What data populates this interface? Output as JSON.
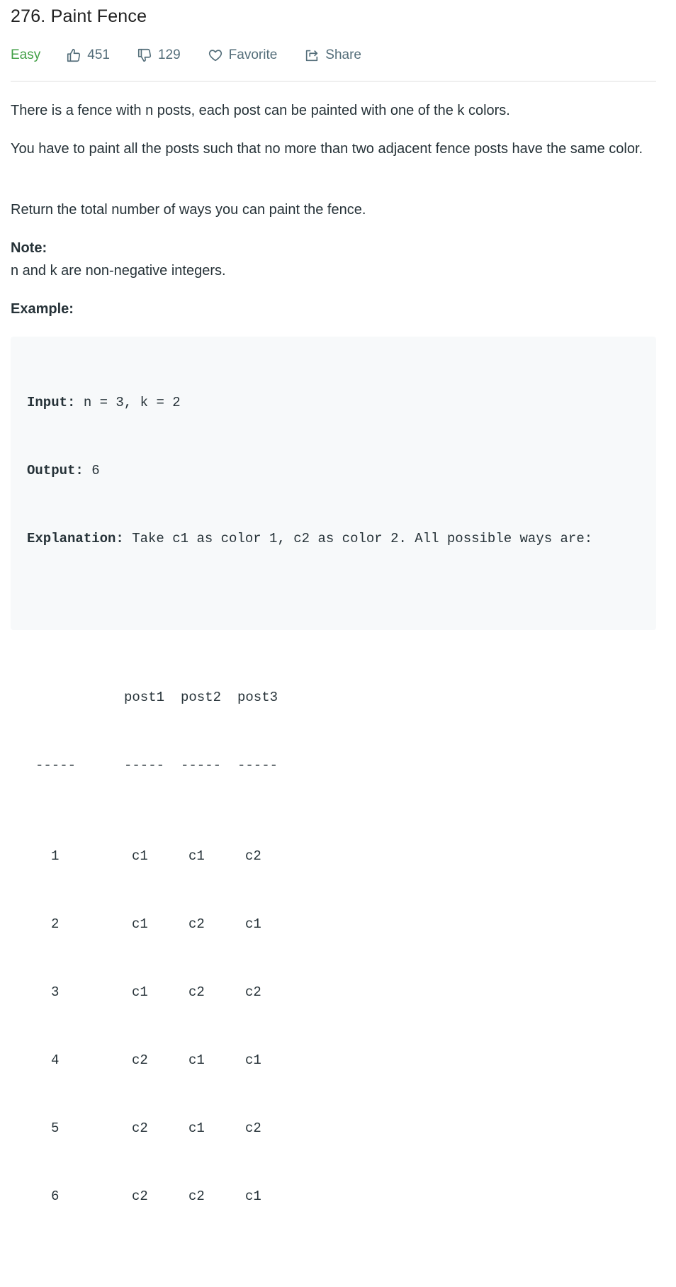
{
  "problem": {
    "title": "276. Paint Fence",
    "difficulty": "Easy",
    "likes": "451",
    "dislikes": "129",
    "favorite_label": "Favorite",
    "share_label": "Share"
  },
  "description": {
    "p1": "There is a fence with n posts, each post can be painted with one of the k colors.",
    "p2": "You have to paint all the posts such that no more than two adjacent fence posts have the same color.",
    "p3": "Return the total number of ways you can paint the fence.",
    "note_label": "Note:",
    "note_text": "n and k are non-negative integers.",
    "example_label": "Example:"
  },
  "example": {
    "input_label": "Input:",
    "input_value": " n = 3, k = 2",
    "output_label": "Output:",
    "output_value": " 6",
    "explanation_label": "Explanation:",
    "explanation_value": " Take c1 as color 1, c2 as color 2. All possible ways are:",
    "headers": [
      "post1",
      "post2",
      "post3"
    ],
    "separator": "-----",
    "rows": [
      {
        "n": "1",
        "p1": "c1",
        "p2": "c1",
        "p3": "c2"
      },
      {
        "n": "2",
        "p1": "c1",
        "p2": "c2",
        "p3": "c1"
      },
      {
        "n": "3",
        "p1": "c1",
        "p2": "c2",
        "p3": "c2"
      },
      {
        "n": "4",
        "p1": "c2",
        "p2": "c1",
        "p3": "c1"
      },
      {
        "n": "5",
        "p1": "c2",
        "p2": "c1",
        "p3": "c2"
      },
      {
        "n": "6",
        "p1": "c2",
        "p2": "c2",
        "p3": "c1"
      }
    ]
  },
  "colors": {
    "easy": "#43a047",
    "meta": "#546e7a",
    "text": "#263238",
    "code_bg": "#f7f9fa"
  },
  "icons": [
    "thumbs-up-icon",
    "thumbs-down-icon",
    "heart-icon",
    "share-icon"
  ]
}
